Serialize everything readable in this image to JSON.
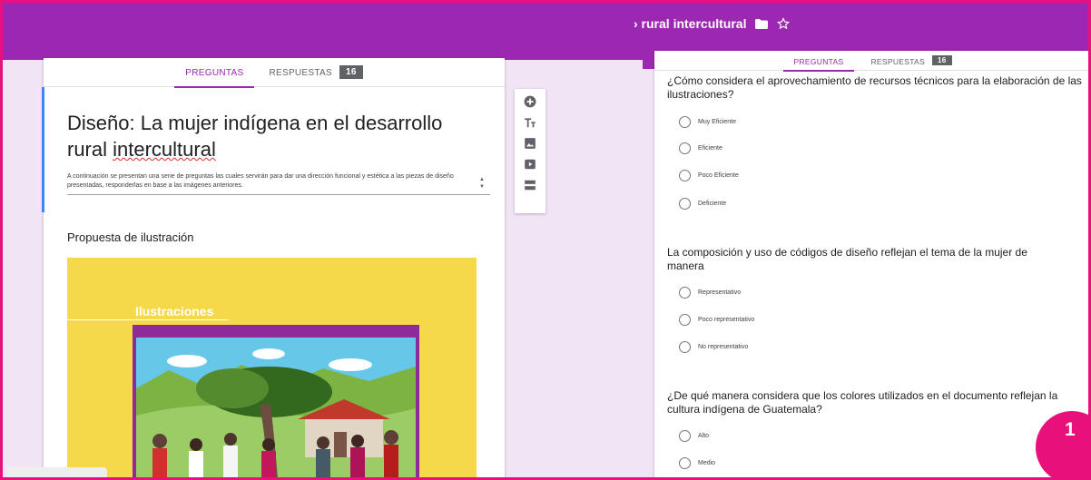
{
  "header": {
    "title_fragment": "› rural intercultural",
    "folder_icon": "folder-icon",
    "star_icon": "star-icon"
  },
  "left_panel": {
    "tabs": {
      "questions": "PREGUNTAS",
      "responses": "RESPUESTAS",
      "responses_count": "16"
    },
    "form_title_line1": "Diseño: La mujer indígena en el desarrollo",
    "form_title_line2_a": "rural ",
    "form_title_line2_b": "intercultural",
    "description": "A continuación se presentan una serie de preguntas las cuales servirán para dar una dirección funcional y estética a las piezas de diseño presentadas, responderlas en base a las imágenes anteriores.",
    "section_title": "Propuesta de ilustración",
    "image_caption": "Ilustraciones"
  },
  "toolbar": {
    "items": [
      "add-question-icon",
      "add-title-icon",
      "add-image-icon",
      "add-video-icon",
      "add-section-icon"
    ]
  },
  "right_panel": {
    "tabs": {
      "questions": "PREGUNTAS",
      "responses": "RESPUESTAS",
      "responses_count": "16"
    },
    "questions": [
      {
        "text": "¿Cómo considera el aprovechamiento de recursos técnicos para la elaboración de las ilustraciones?",
        "options": [
          "Muy Eficiente",
          "Eficiente",
          "Poco Eficiente",
          "Deficiente"
        ]
      },
      {
        "text": "La composición y uso de códigos de diseño reflejan el tema de la mujer de manera",
        "options": [
          "Representativo",
          "Poco representativo",
          "No representativo"
        ]
      },
      {
        "text": "¿De qué manera considera que los colores utilizados en el documento reflejan la cultura indígena de Guatemala?",
        "options": [
          "Alto",
          "Medio"
        ]
      }
    ]
  },
  "corner_badge": "1",
  "colors": {
    "brand": "#9c27b0",
    "accent": "#e8107a",
    "focus": "#4285f4"
  }
}
